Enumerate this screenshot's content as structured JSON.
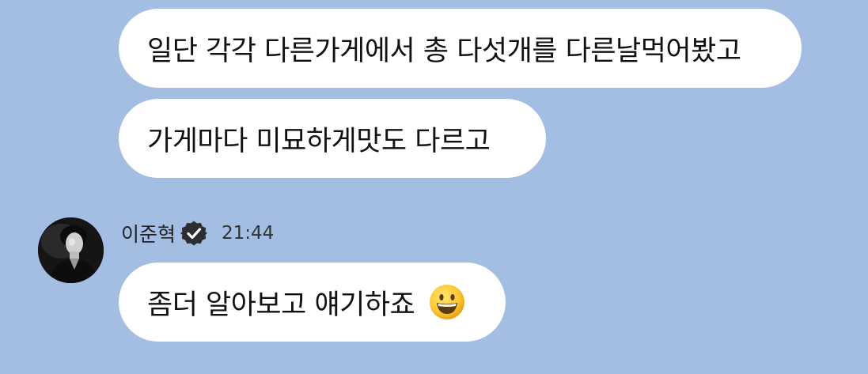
{
  "messages_previous": [
    {
      "text": "일단 각각 다른가게에서 총 다섯개를 다른날먹어봤고"
    },
    {
      "text": "가게마다 미묘하게맛도 다르고"
    }
  ],
  "latest_group": {
    "sender_name": "이준혁",
    "verified_icon": "verified-badge-icon",
    "time": "21:44",
    "message": {
      "text": "좀더 알아보고 얘기하죠",
      "emoji": "grinning-face-emoji"
    }
  },
  "colors": {
    "background": "#a3bde3",
    "bubble": "#ffffff",
    "verified_badge": "#2b2d33"
  }
}
